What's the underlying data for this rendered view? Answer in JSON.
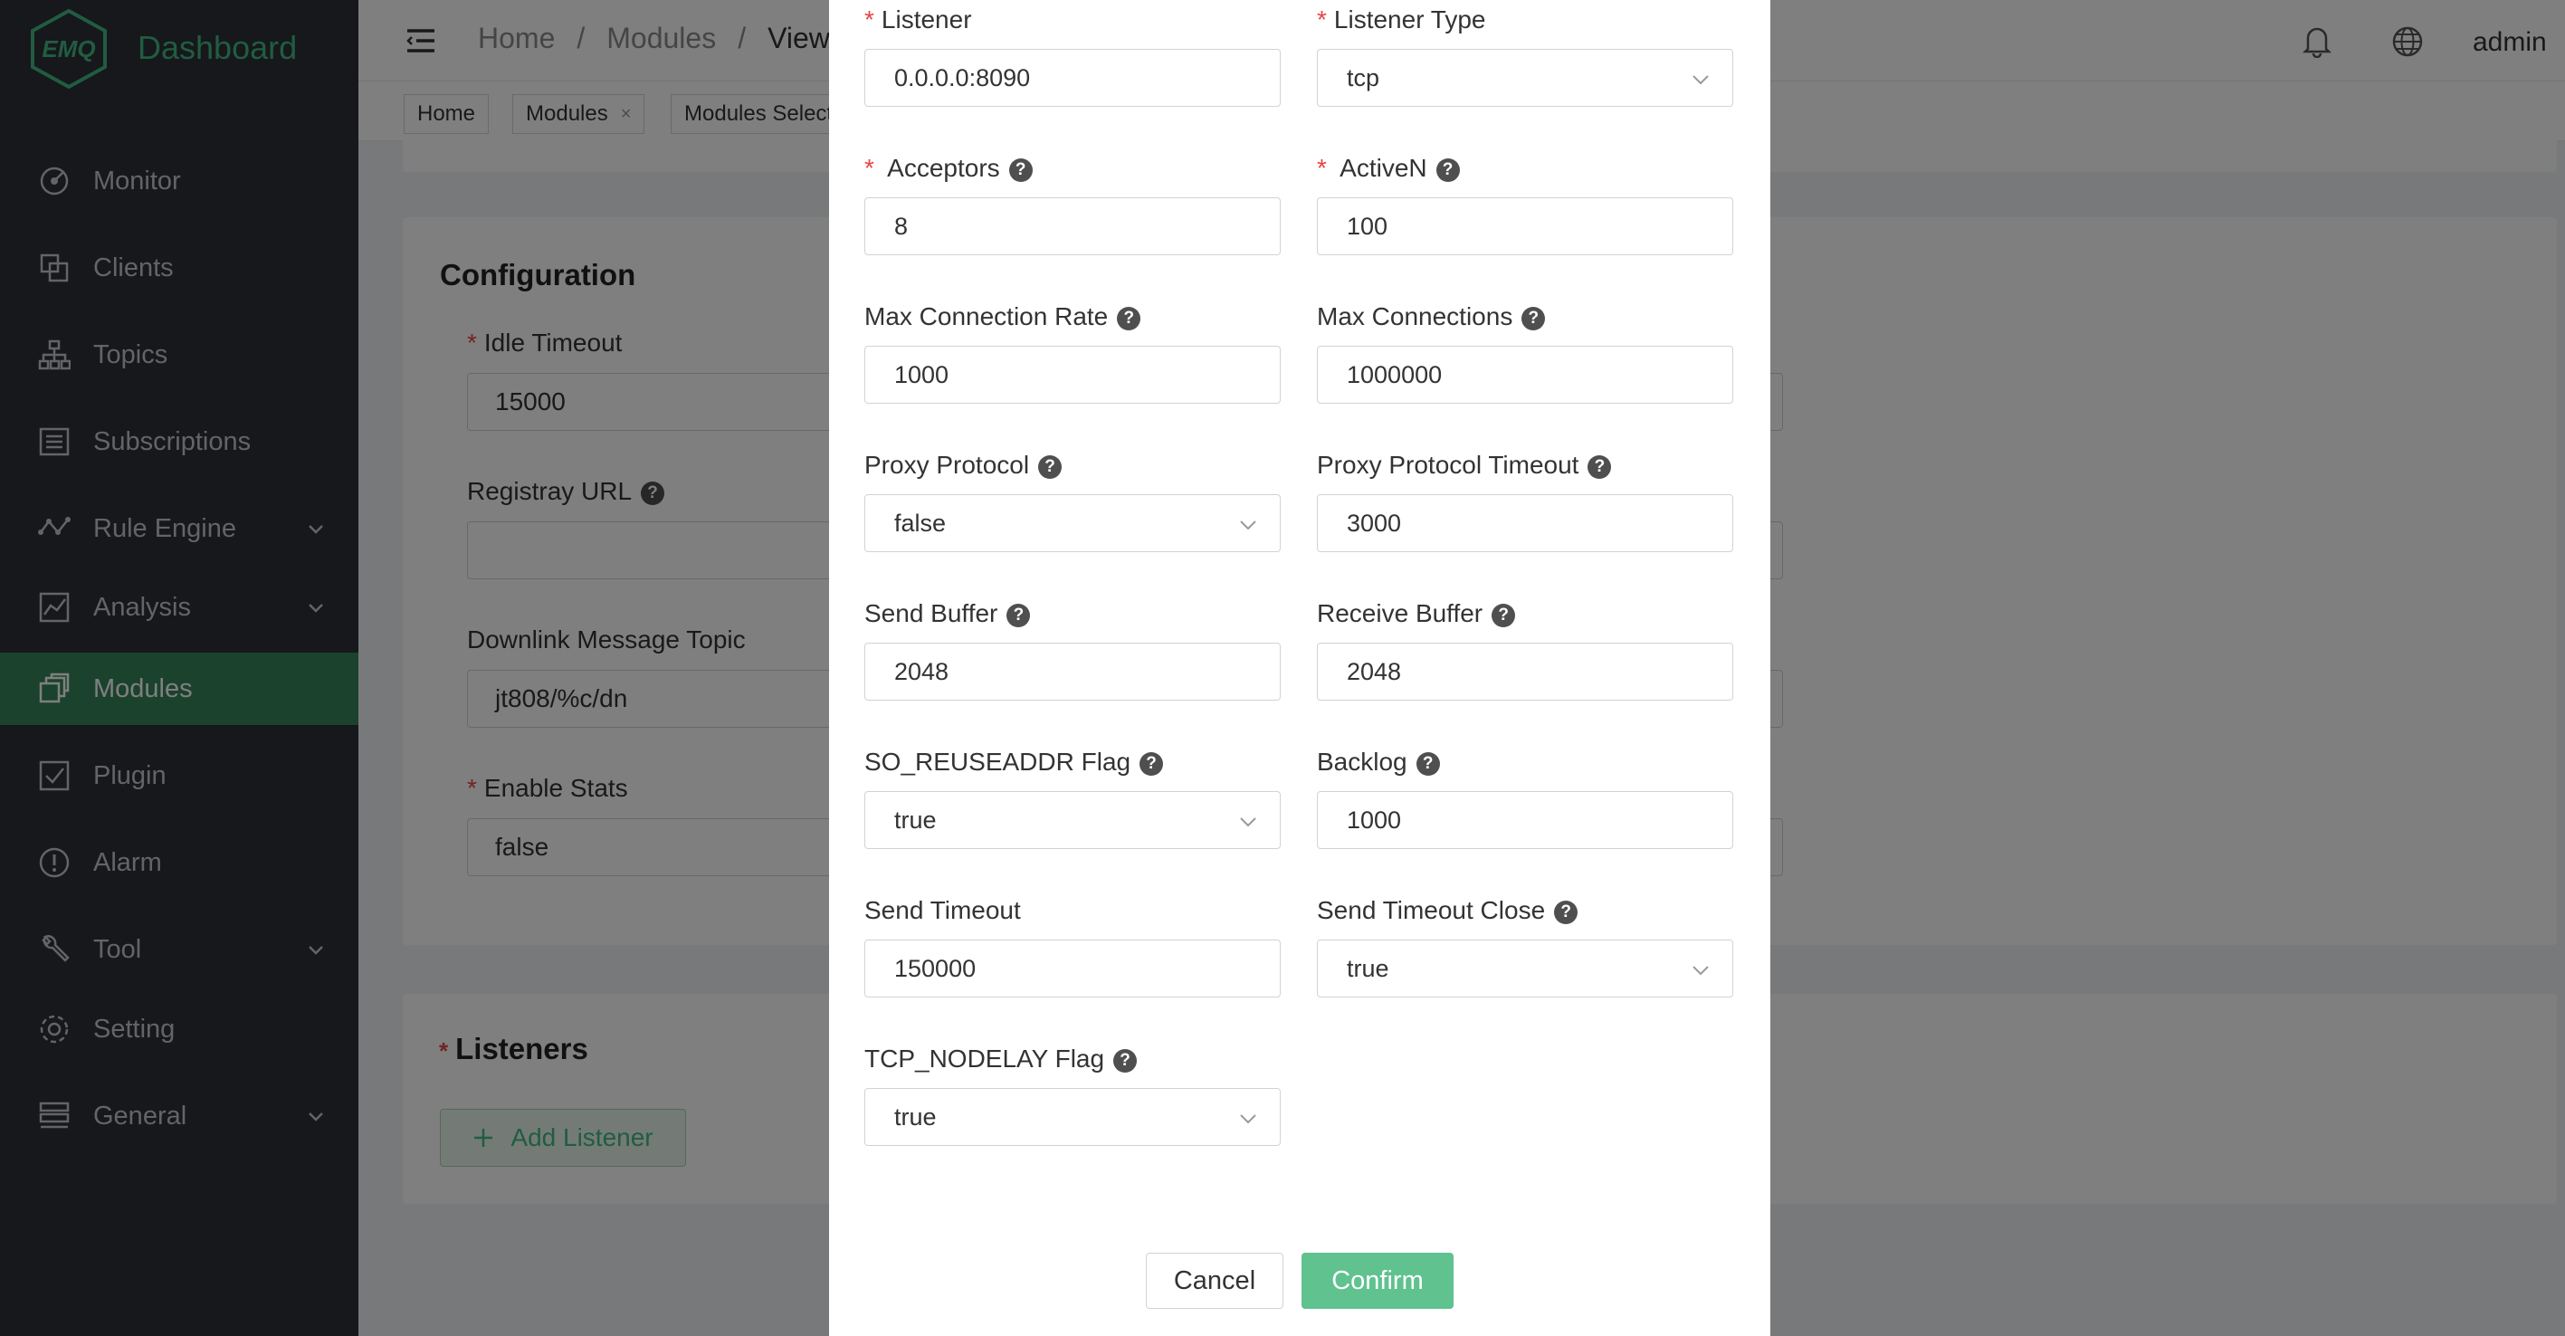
{
  "app": {
    "title": "Dashboard",
    "logo_text": "EMQ"
  },
  "sidebar": {
    "items": [
      {
        "label": "Monitor"
      },
      {
        "label": "Clients"
      },
      {
        "label": "Topics"
      },
      {
        "label": "Subscriptions"
      },
      {
        "label": "Rule Engine"
      },
      {
        "label": "Analysis"
      },
      {
        "label": "Modules"
      },
      {
        "label": "Plugin"
      },
      {
        "label": "Alarm"
      },
      {
        "label": "Tool"
      },
      {
        "label": "Setting"
      },
      {
        "label": "General"
      }
    ]
  },
  "header": {
    "breadcrumb": [
      "Home",
      "/",
      "Modules",
      "/",
      "View"
    ],
    "user": "admin"
  },
  "tags": [
    {
      "label": "Home"
    },
    {
      "label": "Modules",
      "close": "×"
    },
    {
      "label": "Modules Select"
    }
  ],
  "config": {
    "title": "Configuration",
    "idle_timeout": {
      "label": "Idle Timeout",
      "value": "15000"
    },
    "registray_url": {
      "label": "Registray URL",
      "value": ""
    },
    "downlink_topic": {
      "label": "Downlink Message Topic",
      "value": "jt808/%c/dn"
    },
    "enable_stats": {
      "label": "Enable Stats",
      "value": "false"
    }
  },
  "listeners": {
    "title": "Listeners",
    "add_label": "Add Listener"
  },
  "dialog": {
    "listener": {
      "label": "Listener",
      "value": "0.0.0.0:8090"
    },
    "listener_type": {
      "label": "Listener Type",
      "value": "tcp"
    },
    "acceptors": {
      "label": "Acceptors",
      "value": "8"
    },
    "active_n": {
      "label": "ActiveN",
      "value": "100"
    },
    "max_conn_rate": {
      "label": "Max Connection Rate",
      "value": "1000"
    },
    "max_connections": {
      "label": "Max Connections",
      "value": "1000000"
    },
    "proxy_protocol": {
      "label": "Proxy Protocol",
      "value": "false"
    },
    "proxy_protocol_timeout": {
      "label": "Proxy Protocol Timeout",
      "value": "3000"
    },
    "send_buffer": {
      "label": "Send Buffer",
      "value": "2048"
    },
    "receive_buffer": {
      "label": "Receive Buffer",
      "value": "2048"
    },
    "reuseaddr": {
      "label": "SO_REUSEADDR Flag",
      "value": "true"
    },
    "backlog": {
      "label": "Backlog",
      "value": "1000"
    },
    "send_timeout": {
      "label": "Send Timeout",
      "value": "150000"
    },
    "send_timeout_close": {
      "label": "Send Timeout Close",
      "value": "true"
    },
    "nodelay": {
      "label": "TCP_NODELAY Flag",
      "value": "true"
    },
    "cancel_label": "Cancel",
    "confirm_label": "Confirm"
  },
  "colors": {
    "accent": "#42b983",
    "sidebar_bg": "#2c3036",
    "active_bg": "#34855a",
    "required": "#e64545"
  },
  "icons": [
    "monitor-icon",
    "clients-icon",
    "topics-icon",
    "subscriptions-icon",
    "rule-engine-icon",
    "analysis-icon",
    "modules-icon",
    "plugin-icon",
    "alarm-icon",
    "tool-icon",
    "setting-icon",
    "general-icon",
    "bell-icon",
    "globe-icon",
    "hamburger-icon",
    "help-icon",
    "chevron-down-icon",
    "plus-icon"
  ]
}
